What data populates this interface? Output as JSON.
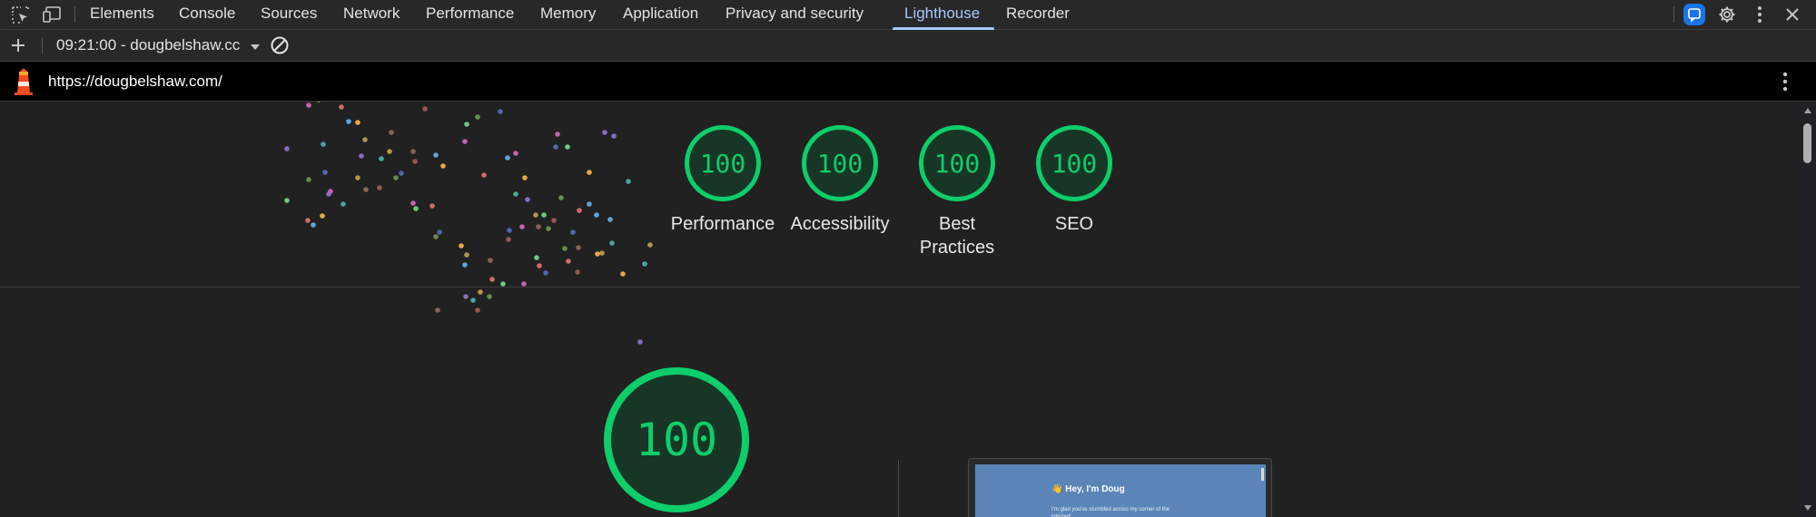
{
  "tabs": [
    {
      "label": "Elements",
      "active": false
    },
    {
      "label": "Console",
      "active": false
    },
    {
      "label": "Sources",
      "active": false
    },
    {
      "label": "Network",
      "active": false
    },
    {
      "label": "Performance",
      "active": false
    },
    {
      "label": "Memory",
      "active": false
    },
    {
      "label": "Application",
      "active": false
    },
    {
      "label": "Privacy and security",
      "active": false
    },
    {
      "label": "Lighthouse",
      "active": true
    },
    {
      "label": "Recorder",
      "active": false
    }
  ],
  "toolbar": {
    "report": "09:21:00 - dougbelshaw.cc",
    "icons": [
      "plus-icon",
      "chevron-down-icon",
      "clear-icon"
    ]
  },
  "urlbar": {
    "url": "https://dougbelshaw.com/",
    "icons": [
      "lighthouse-icon",
      "kebab-menu-icon"
    ]
  },
  "scores": [
    {
      "label": "Performance",
      "score": "100"
    },
    {
      "label": "Accessibility",
      "score": "100"
    },
    {
      "label": "Best Practices",
      "score": "100"
    },
    {
      "label": "SEO",
      "score": "100"
    }
  ],
  "big_score": "100",
  "thumbnail": {
    "title": "👋 Hey, I'm Doug",
    "text": "I'm glad you've stumbled across my corner of the internet!"
  },
  "colors": {
    "accent": "#a8c7fa",
    "pass": "#0cce6b",
    "pass_bg": "#183626",
    "gear_badge": "#1a73e8"
  }
}
